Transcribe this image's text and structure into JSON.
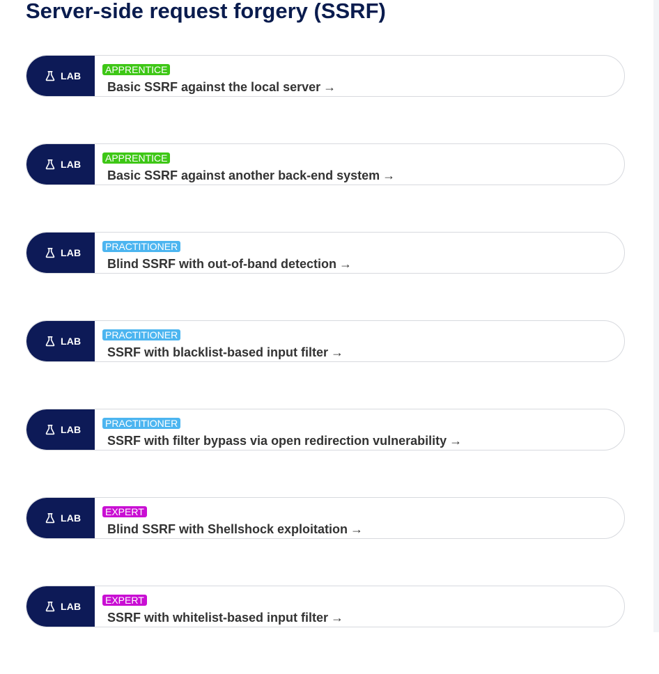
{
  "page": {
    "title": "Server-side request forgery (SSRF)"
  },
  "colors": {
    "title": "#0a1c4e",
    "lab_tag_bg": "#0d1a57",
    "apprentice": "#3ec716",
    "practitioner": "#4cb5f0",
    "expert": "#c90fd3",
    "card_border": "#d7d9de",
    "lab_text": "#333333"
  },
  "labs": [
    {
      "tag": "LAB",
      "tag_icon": "flask-icon",
      "level": "APPRENTICE",
      "title": "Basic SSRF against the local server",
      "arrow": "→"
    },
    {
      "tag": "LAB",
      "tag_icon": "flask-icon",
      "level": "APPRENTICE",
      "title": "Basic SSRF against another back-end system",
      "arrow": "→"
    },
    {
      "tag": "LAB",
      "tag_icon": "flask-icon",
      "level": "PRACTITIONER",
      "title": "Blind SSRF with out-of-band detection",
      "arrow": "→"
    },
    {
      "tag": "LAB",
      "tag_icon": "flask-icon",
      "level": "PRACTITIONER",
      "title": "SSRF with blacklist-based input filter",
      "arrow": "→"
    },
    {
      "tag": "LAB",
      "tag_icon": "flask-icon",
      "level": "PRACTITIONER",
      "title": "SSRF with filter bypass via open redirection vulnerability",
      "arrow": "→"
    },
    {
      "tag": "LAB",
      "tag_icon": "flask-icon",
      "level": "EXPERT",
      "title": "Blind SSRF with Shellshock exploitation",
      "arrow": "→"
    },
    {
      "tag": "LAB",
      "tag_icon": "flask-icon",
      "level": "EXPERT",
      "title": "SSRF with whitelist-based input filter",
      "arrow": "→"
    }
  ]
}
